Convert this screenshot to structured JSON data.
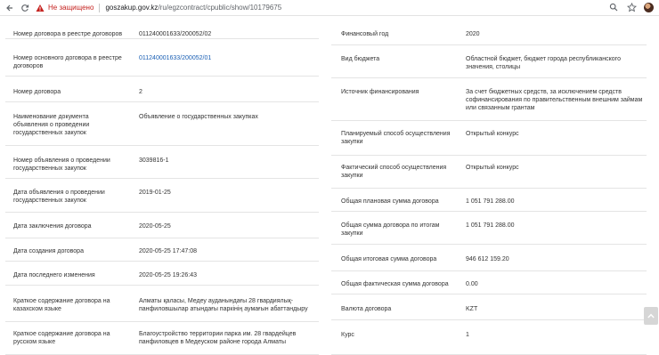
{
  "browser": {
    "security_label": "Не защищено",
    "url_host": "goszakup.gov.kz",
    "url_path": "/ru/egzcontract/cpublic/show/10179675"
  },
  "left_rows": [
    {
      "label": "Номер договора в реестре договоров",
      "value": "011240001633/200052/02"
    },
    {
      "label": "Номер основного договора в реестре договоров",
      "value": "011240001633/200052/01"
    },
    {
      "label": "Номер договора",
      "value": "2"
    },
    {
      "label": "Наименование документа объявления о проведении государственных закупок",
      "value": "Объявление о государственных закупках"
    },
    {
      "label": "Номер объявления о проведении государственных закупок",
      "value": "3039816-1"
    },
    {
      "label": "Дата объявления о проведении государственных закупок",
      "value": "2019-01-25"
    },
    {
      "label": "Дата заключения договора",
      "value": "2020-05-25"
    },
    {
      "label": "Дата создания договора",
      "value": "2020-05-25 17:47:08"
    },
    {
      "label": "Дата последнего изменения",
      "value": "2020-05-25 19:26:43"
    },
    {
      "label": "Краткое содержание договора на казахском языке",
      "value": "Алматы қаласы, Медеу ауданындағы 28 гвардиялық-панфиловшылар атындағы паркінің аумағын абаттандыру"
    },
    {
      "label": "Краткое содержание договора на русском языке",
      "value": "Благоустройство территории парка им. 28 гвардейцев панфиловцев в Медеуском районе города Алматы"
    }
  ],
  "right_rows": [
    {
      "label": "Финансовый год",
      "value": "2020"
    },
    {
      "label": "Вид бюджета",
      "value": "Областной бюджет, бюджет города республиканского значения, столицы"
    },
    {
      "label": "Источник финансирования",
      "value": "За счет бюджетных средств, за исключением средств софинансирования по правительственным внешним займам или связанным грантам"
    },
    {
      "label": "Планируемый способ осуществления закупки",
      "value": "Открытый конкурс"
    },
    {
      "label": "Фактический способ осуществления закупки",
      "value": "Открытый конкурс"
    },
    {
      "label": "Общая плановая сумма договора",
      "value": "1 051 791 288.00"
    },
    {
      "label": "Общая сумма договора по итогам закупки",
      "value": "1 051 791 288.00"
    },
    {
      "label": "Общая итоговая сумма договора",
      "value": "946 612 159.20"
    },
    {
      "label": "Общая фактическая сумма договора",
      "value": "0.00"
    },
    {
      "label": "Валюта договора",
      "value": "KZT"
    },
    {
      "label": "Курс",
      "value": "1"
    }
  ]
}
